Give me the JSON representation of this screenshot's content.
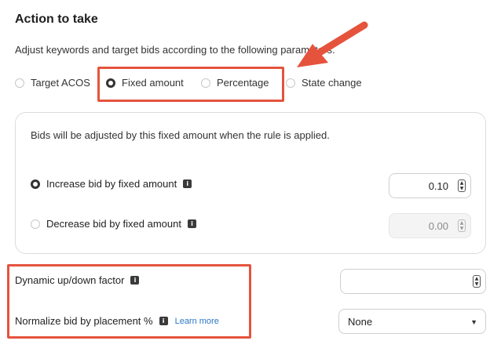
{
  "section": {
    "title": "Action to take",
    "description": "Adjust keywords and target bids according to the following parameters."
  },
  "action_types": [
    {
      "label": "Target ACOS",
      "selected": false
    },
    {
      "label": "Fixed amount",
      "selected": true
    },
    {
      "label": "Percentage",
      "selected": false
    },
    {
      "label": "State change",
      "selected": false
    }
  ],
  "fixed_amount_card": {
    "description": "Bids will be adjusted by this fixed amount when the rule is applied.",
    "increase": {
      "label": "Increase bid by fixed amount",
      "value": "0.10",
      "selected": true
    },
    "decrease": {
      "label": "Decrease bid by fixed amount",
      "value": "0.00",
      "selected": false
    }
  },
  "dynamic_factor": {
    "label": "Dynamic up/down factor",
    "value": ""
  },
  "normalize": {
    "label": "Normalize bid by placement %",
    "learn_more": "Learn more",
    "selected": "None"
  },
  "icons": {
    "info": "info-icon",
    "spinner": "number-spinner-icon",
    "dropdown": "chevron-down-icon",
    "arrow": "annotation-arrow"
  },
  "colors": {
    "annotation_red": "#e5533d",
    "link": "#2a78c6",
    "radio_selected": "#333333"
  }
}
